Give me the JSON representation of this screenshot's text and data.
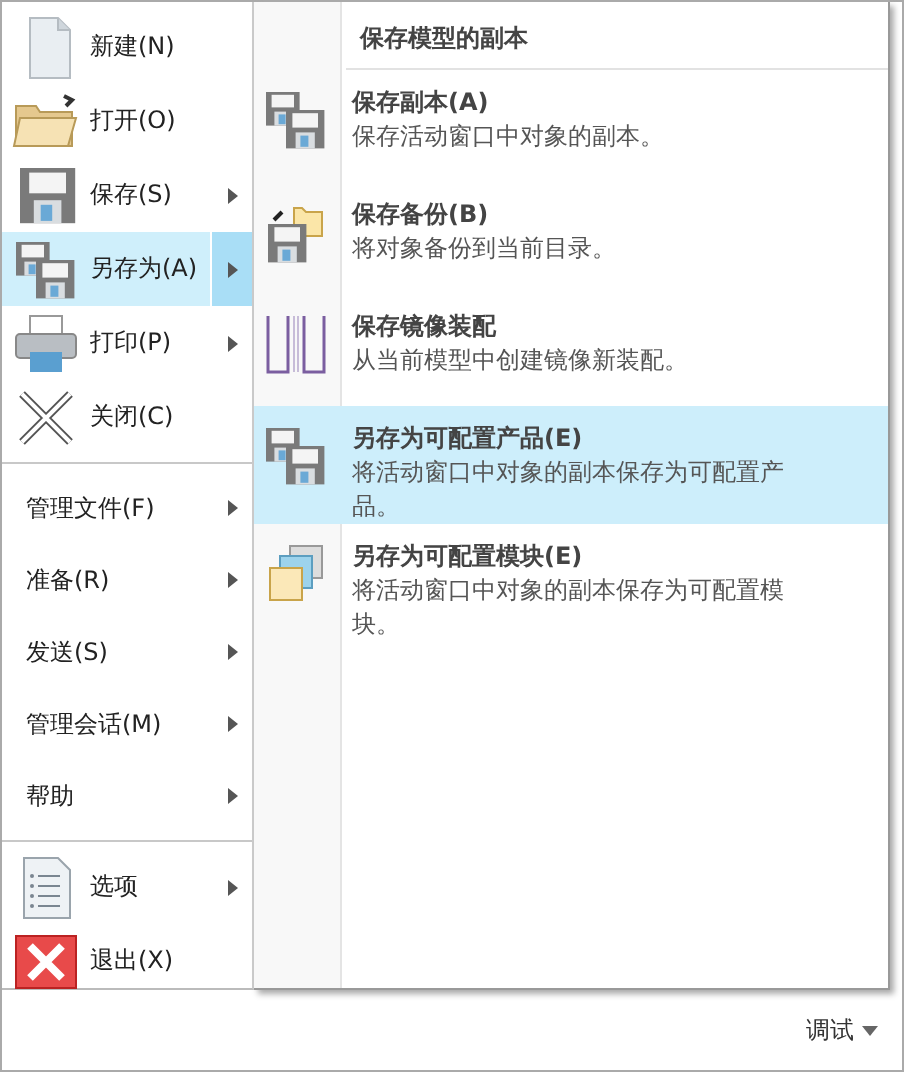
{
  "menu": {
    "groups": [
      [
        {
          "kind": "new",
          "label": "新建(N)",
          "submenu": false,
          "selected": false
        },
        {
          "kind": "open",
          "label": "打开(O)",
          "submenu": false,
          "selected": false
        },
        {
          "kind": "save",
          "label": "保存(S)",
          "submenu": true,
          "selected": false
        },
        {
          "kind": "saveas",
          "label": "另存为(A)",
          "submenu": true,
          "selected": true
        },
        {
          "kind": "print",
          "label": "打印(P)",
          "submenu": true,
          "selected": false
        },
        {
          "kind": "close",
          "label": "关闭(C)",
          "submenu": false,
          "selected": false
        }
      ],
      [
        {
          "kind": "text",
          "label": "管理文件(F)",
          "submenu": true,
          "selected": false
        },
        {
          "kind": "text",
          "label": "准备(R)",
          "submenu": true,
          "selected": false
        },
        {
          "kind": "text",
          "label": "发送(S)",
          "submenu": true,
          "selected": false
        },
        {
          "kind": "text",
          "label": "管理会话(M)",
          "submenu": true,
          "selected": false
        },
        {
          "kind": "text",
          "label": "帮助",
          "submenu": true,
          "selected": false
        }
      ],
      [
        {
          "kind": "options",
          "label": "选项",
          "submenu": true,
          "selected": false
        },
        {
          "kind": "exit",
          "label": "退出(X)",
          "submenu": false,
          "selected": false
        }
      ]
    ]
  },
  "submenu": {
    "header": "保存模型的副本",
    "items": [
      {
        "kind": "saveas",
        "title": "保存副本(A)",
        "description": "保存活动窗口中对象的副本。",
        "selected": false
      },
      {
        "kind": "backup",
        "title": "保存备份(B)",
        "description": "将对象备份到当前目录。",
        "selected": false
      },
      {
        "kind": "mirror",
        "title": "保存镜像装配",
        "description": "从当前模型中创建镜像新装配。",
        "selected": false
      },
      {
        "kind": "saveas",
        "title": "另存为可配置产品(E)",
        "description": "将活动窗口中对象的副本保存为可配置产品。",
        "selected": true
      },
      {
        "kind": "module",
        "title": "另存为可配置模块(E)",
        "description": "将活动窗口中对象的副本保存为可配置模块。",
        "selected": false
      }
    ]
  },
  "status_bar": {
    "label": "调试"
  }
}
